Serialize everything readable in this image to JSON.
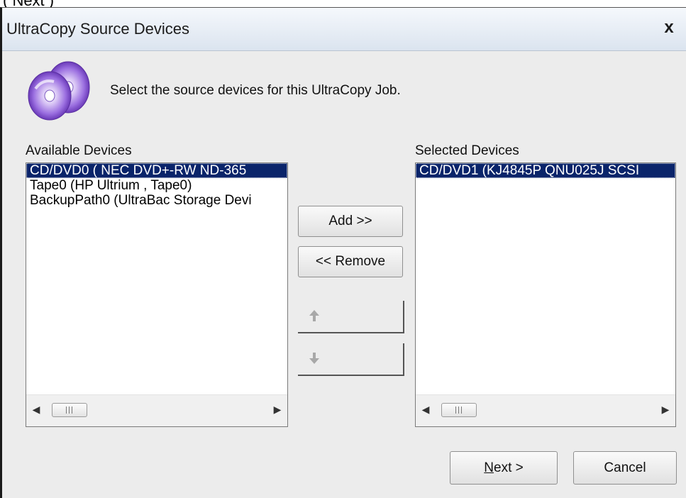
{
  "top_fragment": "( Next )",
  "window": {
    "title": "UltraCopy Source Devices",
    "close_glyph": "x"
  },
  "icon": "cd-discs-icon",
  "instruction": "Select the source devices for this UltraCopy Job.",
  "available": {
    "label": "Available Devices",
    "items": [
      "CD/DVD0 (  NEC DVD+-RW ND-365",
      "Tape0 (HP      Ultrium , Tape0)",
      "BackupPath0 (UltraBac Storage Devi"
    ],
    "selected_index": 0
  },
  "selected": {
    "label": "Selected Devices",
    "items": [
      "CD/DVD1 (KJ4845P QNU025J SCSI"
    ],
    "selected_index": 0
  },
  "buttons": {
    "add": "Add >>",
    "remove": "<< Remove",
    "move_up_icon": "arrow-up-icon",
    "move_down_icon": "arrow-down-icon",
    "next_mnemonic": "N",
    "next_rest": "ext >",
    "cancel": "Cancel"
  },
  "colors": {
    "selection_bg": "#0a246a",
    "dialog_bg": "#ececec"
  }
}
